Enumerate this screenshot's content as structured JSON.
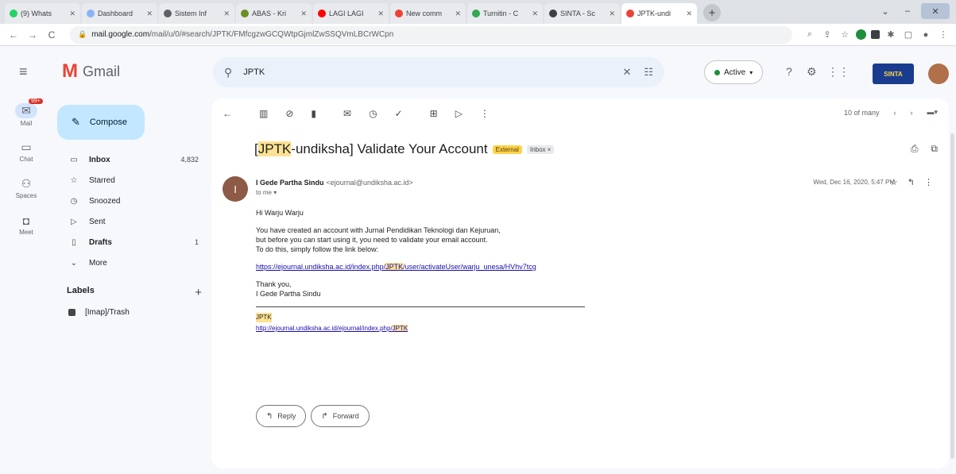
{
  "browser": {
    "tabs": [
      {
        "label": "(9) Whats",
        "color": "#25d366"
      },
      {
        "label": "Dashboard",
        "color": "#8ab4f8"
      },
      {
        "label": "Sistem Inf",
        "color": "#5f6368"
      },
      {
        "label": "ABAS - Kri",
        "color": "#6b8e23"
      },
      {
        "label": "LAGI LAGI",
        "color": "#ff0000"
      },
      {
        "label": "New comm",
        "color": "#ea4335"
      },
      {
        "label": "Turnitin - C",
        "color": "#34a853"
      },
      {
        "label": "SINTA - Sc",
        "color": "#3c4043"
      },
      {
        "label": "JPTK-undi",
        "color": "#ea4335",
        "active": true
      }
    ],
    "url_host": "mail.google.com",
    "url_path": "/mail/u/0/#search/JPTK/FMfcgzwGCQWtpGjmlZwSSQVmLBCrWCpn"
  },
  "gmail": {
    "logo_text": "Gmail",
    "search_value": "JPTK",
    "status_label": "Active",
    "brand_text": "SINTA"
  },
  "rail": [
    {
      "label": "Mail",
      "badge": "99+"
    },
    {
      "label": "Chat"
    },
    {
      "label": "Spaces"
    },
    {
      "label": "Meet"
    }
  ],
  "sidebar": {
    "compose_label": "Compose",
    "items": [
      {
        "label": "Inbox",
        "count": "4,832",
        "icon": "▭",
        "bold": true
      },
      {
        "label": "Starred",
        "count": "",
        "icon": "☆"
      },
      {
        "label": "Snoozed",
        "count": "",
        "icon": "◷"
      },
      {
        "label": "Sent",
        "count": "",
        "icon": "▷"
      },
      {
        "label": "Drafts",
        "count": "1",
        "icon": "▯",
        "bold": true
      },
      {
        "label": "More",
        "count": "",
        "icon": "⌄"
      }
    ],
    "labels_heading": "Labels",
    "labels": [
      {
        "label": "[Imap]/Trash"
      }
    ]
  },
  "toolbar": {
    "pager_text": "10 of many"
  },
  "email": {
    "subject_prefix": "[",
    "subject_highlight": "JPTK",
    "subject_suffix": "-undiksha] Validate Your Account",
    "chip_external": "External",
    "chip_inbox": "Inbox ×",
    "sender_initial": "I",
    "sender_name": "I Gede Partha Sindu",
    "sender_email": "<ejournal@undiksha.ac.id>",
    "to_line": "to me ▾",
    "date": "Wed, Dec 16, 2020, 5:47 PM",
    "greeting": "Hi Warju Warju",
    "para1_line1": "You have created an account with Jurnal Pendidikan Teknologi dan Kejuruan,",
    "para1_line2": "but before you can start using it, you need to validate your email account.",
    "para1_line3": "To do this, simply follow the link below:",
    "link_prefix": "https://ejournal.undiksha.ac.id/index.php/",
    "link_highlight": "JPTK",
    "link_suffix": "/user/activateUser/warju_unesa/HVhv7tcg",
    "thanks": "Thank you,",
    "signoff": "I Gede Partha Sindu",
    "sig_title": "JPTK",
    "sig_link_prefix": "http://ejournal.undiksha.ac.id/ejournal/index.php/",
    "sig_link_highlight": "JPTK",
    "reply_label": "Reply",
    "forward_label": "Forward"
  }
}
